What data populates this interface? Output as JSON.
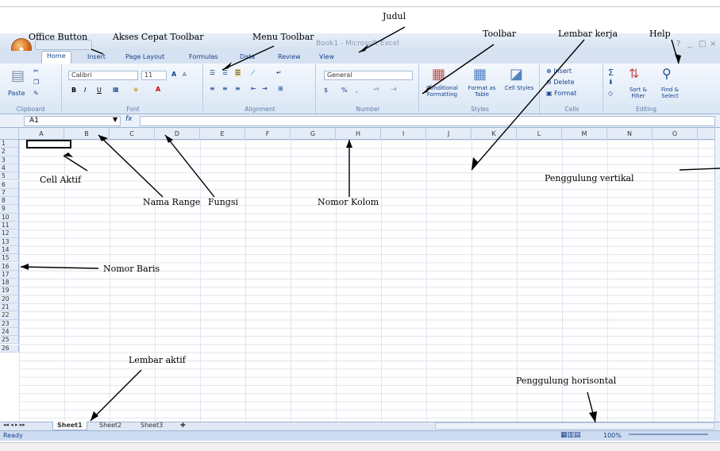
{
  "window": {
    "title": "Book1 - Microsoft Excel",
    "min": "_",
    "max": "□",
    "close": "×"
  },
  "office_button": {
    "label": "Office"
  },
  "tabs": [
    "Home",
    "Insert",
    "Page Layout",
    "Formulas",
    "Data",
    "Review",
    "View"
  ],
  "ribbon": {
    "clipboard": {
      "paste": "Paste",
      "label": "Clipboard"
    },
    "font": {
      "name": "Calibri",
      "size": "11",
      "grow": "A",
      "shrink": "A",
      "bold": "B",
      "italic": "I",
      "underline": "U",
      "label": "Font"
    },
    "alignment": {
      "label": "Alignment"
    },
    "number": {
      "format": "General",
      "percent": "%",
      "comma": ",",
      "label": "Number"
    },
    "styles": {
      "conditional": "Conditional Formatting",
      "format_table": "Format as Table",
      "cell_styles": "Cell Styles",
      "label": "Styles"
    },
    "cells": {
      "insert": "Insert",
      "delete": "Delete",
      "format": "Format",
      "label": "Cells"
    },
    "editing": {
      "sum": "Σ",
      "sort": "Sort & Filter",
      "find": "Find & Select",
      "label": "Editing"
    }
  },
  "formula_bar": {
    "name_box": "A1",
    "fx": "fx"
  },
  "columns": [
    "A",
    "B",
    "C",
    "D",
    "E",
    "F",
    "G",
    "H",
    "I",
    "J",
    "K",
    "L",
    "M",
    "N",
    "O"
  ],
  "rows": [
    "1",
    "2",
    "3",
    "4",
    "5",
    "6",
    "7",
    "8",
    "9",
    "10",
    "11",
    "12",
    "13",
    "14",
    "15",
    "16",
    "17",
    "18",
    "19",
    "20",
    "21",
    "22",
    "23",
    "24",
    "25",
    "26"
  ],
  "sheets": [
    "Sheet1",
    "Sheet2",
    "Sheet3"
  ],
  "status": {
    "ready": "Ready",
    "zoom": "100%"
  },
  "annotations": {
    "judul": "Judul",
    "office_button": "Office Button",
    "akses_cepat": "Akses Cepat Toolbar",
    "menu_toolbar": "Menu Toolbar",
    "toolbar": "Toolbar",
    "lembar_kerja": "Lembar kerja",
    "help": "Help",
    "cell_aktif": "Cell Aktif",
    "nama_range": "Nama Range",
    "fungsi": "Fungsi",
    "nomor_kolom": "Nomor Kolom",
    "penggulung_vertikal": "Penggulung vertikal",
    "nomor_baris": "Nomor Baris",
    "lembar_aktif": "Lembar aktif",
    "penggulung_horisontal": "Penggulung horisontal"
  }
}
